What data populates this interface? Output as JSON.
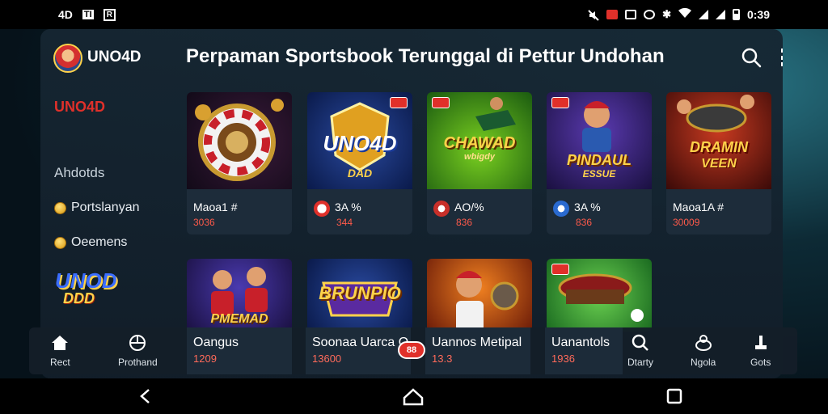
{
  "status_bar": {
    "left": [
      "4D",
      "TI",
      "R"
    ],
    "right_text": "0:39",
    "icons": [
      "mute-icon",
      "notification-icon",
      "nfc-icon",
      "alarm-icon",
      "bluetooth-icon",
      "wifi-icon",
      "signal-icon",
      "signal-icon",
      "battery-icon"
    ]
  },
  "header": {
    "brand": "UNO4D",
    "title": "Perpaman Sportsbook Terunggal di Pettur Undohan"
  },
  "sidebar": {
    "brand": "UNO4D",
    "section": "Ahdotds",
    "items": [
      {
        "label": "Portslanyan",
        "icon": "coin-icon"
      },
      {
        "label": "Oeemens",
        "icon": "coin-icon"
      }
    ],
    "logo_line1": "UNOD",
    "logo_line2": "DDD"
  },
  "games": [
    {
      "art": "roulette-wheel",
      "art_text": "",
      "title": "Maoa1 #",
      "sub": "3036",
      "chip": false
    },
    {
      "art": "uno4d-shield",
      "art_text": "UNO4D",
      "art_sub": "DAD",
      "title": "3A %",
      "sub": "344",
      "chip": true
    },
    {
      "art": "football-player",
      "art_text": "CHAWAD",
      "art_sub": "wbigdy",
      "title": "AO/%",
      "sub": "836",
      "chip": true
    },
    {
      "art": "baseball-player",
      "art_text": "PINDAUL",
      "art_sub": "ESSUE",
      "title": "3A %",
      "sub": "836",
      "chip": true
    },
    {
      "art": "casino-table-players",
      "art_text": "DRAMIN",
      "art_sub": "VEEN",
      "title": "Maoa1A #",
      "sub": "30009",
      "chip": false
    },
    {
      "art": "players-cheering",
      "art_text": "PMEMAD",
      "title": "Oangus",
      "sub": "1209",
      "chip": false
    },
    {
      "art": "brand-shield",
      "art_text": "BRUNPIO",
      "title": "Soonaa Uarca O",
      "sub": "13600",
      "chip": false
    },
    {
      "art": "baseball-kid",
      "art_text": "",
      "title": "Uannos Metipal",
      "sub": "13.3",
      "chip": false
    },
    {
      "art": "card-table",
      "art_text": "",
      "title": "Uanantols",
      "sub": "1936",
      "chip": false
    }
  ],
  "bottom_nav": {
    "left_items": [
      {
        "label": "Rect",
        "icon": "home-icon"
      },
      {
        "label": "Prothand",
        "icon": "sports-ball-icon"
      }
    ],
    "right_items": [
      {
        "label": "Dtarty",
        "icon": "search-icon"
      },
      {
        "label": "Ngola",
        "icon": "bag-icon"
      },
      {
        "label": "Gots",
        "icon": "trophy-icon"
      }
    ],
    "badge": "88"
  },
  "colors": {
    "accent_red": "#e0302a",
    "panel_bg": "#162632",
    "card_bg": "#1d2c3a",
    "gold": "#ffd24a"
  }
}
